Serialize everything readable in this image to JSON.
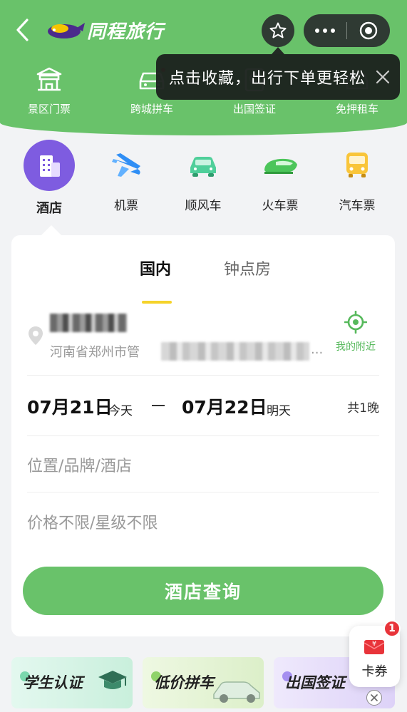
{
  "nav": {
    "brand": "同程旅行",
    "icons": [
      "back-icon",
      "star-icon",
      "more-icon",
      "target-icon"
    ]
  },
  "quick_services": [
    {
      "label": "景区门票",
      "icon": "gate-icon"
    },
    {
      "label": "跨城拼车",
      "icon": "car-icon"
    },
    {
      "label": "出国签证",
      "icon": "visa-icon"
    },
    {
      "label": "免押租车",
      "icon": "rental-icon"
    }
  ],
  "tooltip": {
    "text": "点击收藏，出行下单更轻松",
    "icon": "close-icon"
  },
  "categories": [
    {
      "label": "酒店",
      "icon": "hotel-icon",
      "active": true
    },
    {
      "label": "机票",
      "icon": "plane-icon"
    },
    {
      "label": "顺风车",
      "icon": "carpool-icon"
    },
    {
      "label": "火车票",
      "icon": "train-icon"
    },
    {
      "label": "汽车票",
      "icon": "bus-icon"
    }
  ],
  "booking": {
    "tabs": [
      "国内",
      "钟点房"
    ],
    "location": {
      "address_prefix": "河南省郑州市管",
      "ellipsis": "...",
      "nearby_label": "我的附近"
    },
    "dates": {
      "checkin": "07月21日",
      "checkin_note": "今天",
      "checkout": "07月22日",
      "checkout_note": "明天",
      "nights": "共1晚"
    },
    "keyword_placeholder": "位置/品牌/酒店",
    "filter_placeholder": "价格不限/星级不限",
    "search_label": "酒店查询"
  },
  "promos": [
    {
      "label": "学生认证",
      "color": "#d8f5ea"
    },
    {
      "label": "低价拼车",
      "color": "#eaf6dc"
    },
    {
      "label": "出国签证",
      "color": "#ece6fa"
    }
  ],
  "coupon": {
    "label": "卡券",
    "badge": "1"
  },
  "colors": {
    "brand_green": "#69c26a",
    "hotel_purple": "#7e5ce0",
    "tab_underline": "#f5d32a",
    "badge_red": "#e8343a"
  }
}
